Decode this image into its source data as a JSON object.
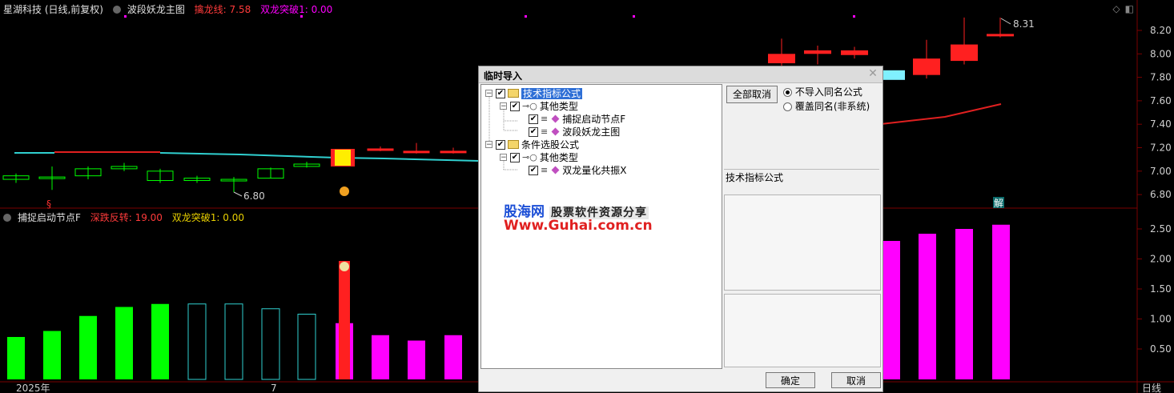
{
  "header": {
    "stock_name": "星湖科技 (日线,前复权)",
    "indicator_name": "波段妖龙主图",
    "line1_label": "擒龙线: 7.58",
    "line2_label": "双龙突破1: 0.00"
  },
  "sub_header": {
    "indicator_name": "捕捉启动节点F",
    "line1_label": "深跌反转: 19.00",
    "line2_label": "双龙突破1: 0.00"
  },
  "axis": {
    "price_ticks": [
      "8.20",
      "8.00",
      "7.80",
      "7.60",
      "7.40",
      "7.20",
      "7.00",
      "6.80"
    ],
    "sub_ticks": [
      "2.50",
      "2.00",
      "1.50",
      "1.00",
      "0.50"
    ],
    "x_labels": [
      "2025年",
      "7"
    ],
    "period_label": "日线",
    "high_label": "8.31",
    "low_label": "6.80",
    "jie_label": "解",
    "signal_s_label": "§"
  },
  "colors": {
    "bull": "#ff2020",
    "bear": "#00ff00",
    "cyan": "#30d0d0",
    "magenta": "#ff00ff",
    "yellow": "#ffee00"
  },
  "dialog": {
    "title": "临时导入",
    "close_icon": "close-icon",
    "tree": [
      {
        "label": "技术指标公式",
        "checked": true,
        "selected": true
      },
      {
        "label": "其他类型",
        "checked": true
      },
      {
        "label": "捕捉启动节点F",
        "checked": true
      },
      {
        "label": "波段妖龙主图",
        "checked": true
      },
      {
        "label": "条件选股公式",
        "checked": true
      },
      {
        "label": "其他类型",
        "checked": true
      },
      {
        "label": "双龙量化共振X",
        "checked": true
      }
    ],
    "watermark_brand": "股海网",
    "watermark_slogan": "股票软件资源分享",
    "watermark_url": "Www.Guhai.com.cn",
    "cancel_all_label": "全部取消",
    "radio_skip_label": "不导入同名公式",
    "radio_overwrite_label": "覆盖同名(非系统)",
    "radio_selected": "skip",
    "info_label": "技术指标公式",
    "ok_label": "确定",
    "cancel_label": "取消"
  }
}
